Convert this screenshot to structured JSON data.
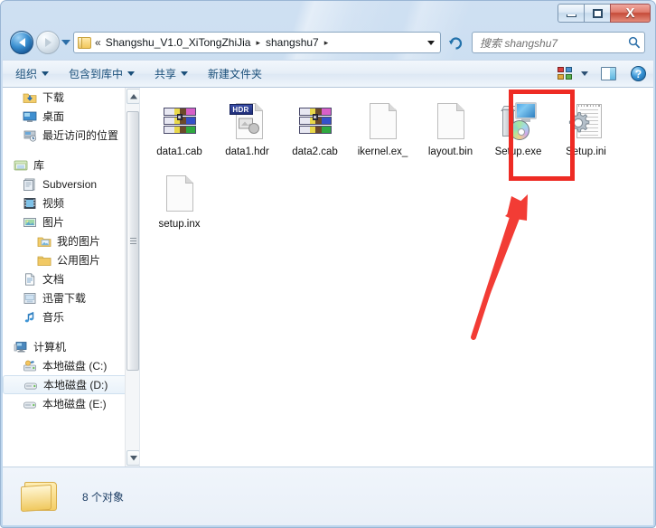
{
  "window": {
    "minimize_label": "Minimize",
    "maximize_label": "Maximize",
    "close_label": "X"
  },
  "address_bar": {
    "back_label": "Back",
    "forward_label": "Forward",
    "recent_dropdown_label": "Recent pages",
    "folder_icon": "folder-icon",
    "overflow_chevron": "«",
    "crumbs": [
      {
        "label": "Shangshu_V1.0_XiTongZhiJia"
      },
      {
        "label": "shangshu7"
      }
    ],
    "separator": "▸",
    "dropdown_label": "Previous locations",
    "refresh_label": "Refresh"
  },
  "search": {
    "placeholder": "搜索 shangshu7",
    "value": "",
    "icon": "search-icon"
  },
  "command_bar": {
    "items": [
      {
        "label": "组织",
        "has_caret": true
      },
      {
        "label": "包含到库中",
        "has_caret": true
      },
      {
        "label": "共享",
        "has_caret": true
      },
      {
        "label": "新建文件夹",
        "has_caret": false
      }
    ],
    "view_label": "更改您的视图",
    "preview_pane_label": "显示预览窗格",
    "help_label": "?"
  },
  "sidebar": {
    "items": [
      {
        "label": "下载",
        "icon": "download-folder-icon",
        "level": 1,
        "selected": false
      },
      {
        "label": "桌面",
        "icon": "desktop-icon",
        "level": 1,
        "selected": false
      },
      {
        "label": "最近访问的位置",
        "icon": "recent-places-icon",
        "level": 1,
        "selected": false
      },
      {
        "label": "库",
        "icon": "library-icon",
        "level": 0,
        "selected": false,
        "spacer_before": true
      },
      {
        "label": "Subversion",
        "icon": "subversion-icon",
        "level": 1,
        "selected": false
      },
      {
        "label": "视频",
        "icon": "videos-icon",
        "level": 1,
        "selected": false
      },
      {
        "label": "图片",
        "icon": "pictures-icon",
        "level": 1,
        "selected": false
      },
      {
        "label": "我的图片",
        "icon": "my-pictures-icon",
        "level": 2,
        "selected": false
      },
      {
        "label": "公用图片",
        "icon": "public-pictures-icon",
        "level": 2,
        "selected": false
      },
      {
        "label": "文档",
        "icon": "documents-icon",
        "level": 1,
        "selected": false
      },
      {
        "label": "迅雷下载",
        "icon": "thunder-download-icon",
        "level": 1,
        "selected": false
      },
      {
        "label": "音乐",
        "icon": "music-icon",
        "level": 1,
        "selected": false
      },
      {
        "label": "计算机",
        "icon": "computer-icon",
        "level": 0,
        "selected": false,
        "spacer_before": true
      },
      {
        "label": "本地磁盘 (C:)",
        "icon": "system-drive-icon",
        "level": 1,
        "selected": false
      },
      {
        "label": "本地磁盘 (D:)",
        "icon": "drive-icon",
        "level": 1,
        "selected": true
      },
      {
        "label": "本地磁盘 (E:)",
        "icon": "drive-icon",
        "level": 1,
        "selected": false
      }
    ],
    "scroll_up_label": "Scroll up",
    "scroll_down_label": "Scroll down"
  },
  "files": [
    {
      "name": "data1.cab",
      "icon": "winrar-cab-icon",
      "highlighted": false
    },
    {
      "name": "data1.hdr",
      "icon": "hdr-file-icon",
      "highlighted": false
    },
    {
      "name": "data2.cab",
      "icon": "winrar-cab-icon",
      "highlighted": false
    },
    {
      "name": "ikernel.ex_",
      "icon": "blank-document-icon",
      "highlighted": false
    },
    {
      "name": "layout.bin",
      "icon": "blank-document-icon",
      "highlighted": false
    },
    {
      "name": "Setup.exe",
      "icon": "setup-executable-icon",
      "highlighted": true
    },
    {
      "name": "Setup.ini",
      "icon": "ini-config-icon",
      "highlighted": false
    },
    {
      "name": "setup.inx",
      "icon": "blank-document-icon",
      "highlighted": false
    }
  ],
  "annotation": {
    "color": "#ee2b24",
    "target_file": "Setup.exe",
    "shape": "rectangle-and-arrow"
  },
  "status_bar": {
    "folder_icon": "folder-icon",
    "text": "8 个对象"
  },
  "colors": {
    "frame": "#c5dbef",
    "accent_blue": "#1a4f7a",
    "highlight_red": "#ee2b24",
    "titlebar_close": "#c54a38"
  }
}
